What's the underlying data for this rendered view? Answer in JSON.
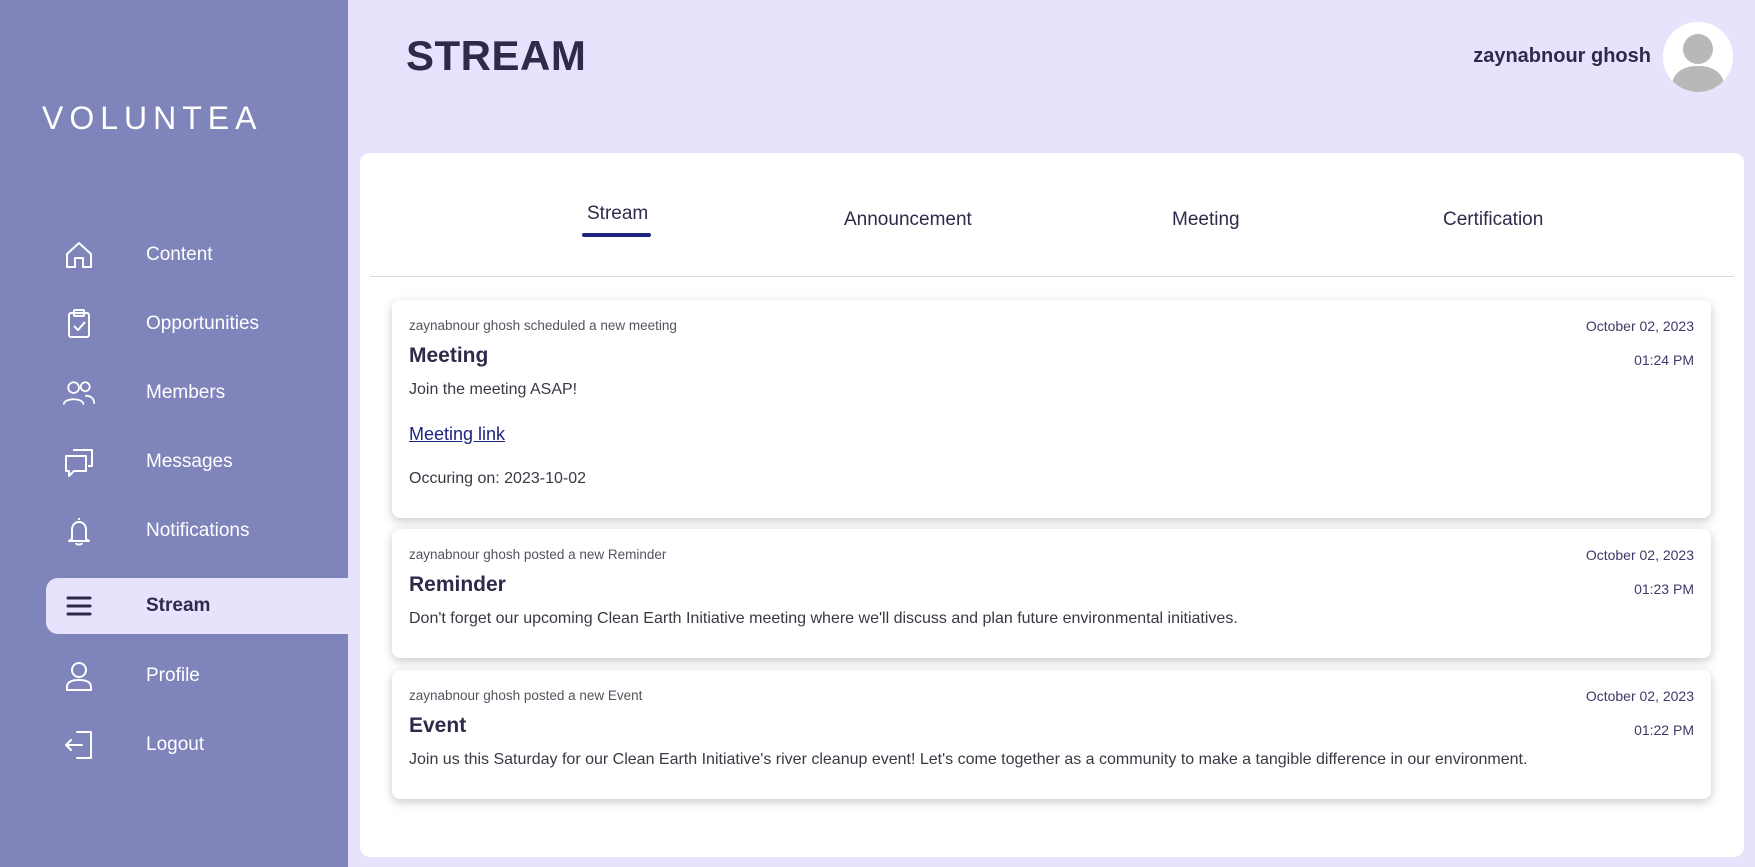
{
  "app": {
    "logo_text": "VOLUNTEA"
  },
  "sidebar": {
    "items": [
      {
        "label": "Content",
        "icon": "home-icon"
      },
      {
        "label": "Opportunities",
        "icon": "clipboard-check-icon"
      },
      {
        "label": "Members",
        "icon": "users-icon"
      },
      {
        "label": "Messages",
        "icon": "chat-icon"
      },
      {
        "label": "Notifications",
        "icon": "bell-icon"
      },
      {
        "label": "Stream",
        "icon": "menu-icon",
        "active": true
      },
      {
        "label": "Profile",
        "icon": "user-icon"
      },
      {
        "label": "Logout",
        "icon": "logout-icon"
      }
    ]
  },
  "header": {
    "title": "STREAM",
    "user_name": "zaynabnour ghosh",
    "avatar_icon": "avatar-icon"
  },
  "tabs": [
    {
      "label": "Stream",
      "active": true
    },
    {
      "label": "Announcement"
    },
    {
      "label": "Meeting"
    },
    {
      "label": "Certification"
    }
  ],
  "posts": [
    {
      "meta": "zaynabnour ghosh scheduled a new meeting",
      "date": "October 02, 2023",
      "time": "01:24 PM",
      "title": "Meeting",
      "body": "Join the meeting ASAP!",
      "link_label": "Meeting link",
      "occurring": "Occuring on: 2023-10-02"
    },
    {
      "meta": "zaynabnour ghosh posted a new Reminder",
      "date": "October 02, 2023",
      "time": "01:23 PM",
      "title": "Reminder",
      "body": "Don't forget our upcoming Clean Earth Initiative meeting where we'll discuss and plan future environmental initiatives."
    },
    {
      "meta": "zaynabnour ghosh posted a new Event",
      "date": "October 02, 2023",
      "time": "01:22 PM",
      "title": "Event",
      "body": "Join us this Saturday for our Clean Earth Initiative's river cleanup event! Let's come together as a community to make a tangible difference in our environment."
    }
  ],
  "colors": {
    "sidebar_bg": "#7f84bb",
    "page_bg": "#e8e3fc",
    "accent": "#1f2480",
    "text_dark": "#2e2a4a"
  }
}
